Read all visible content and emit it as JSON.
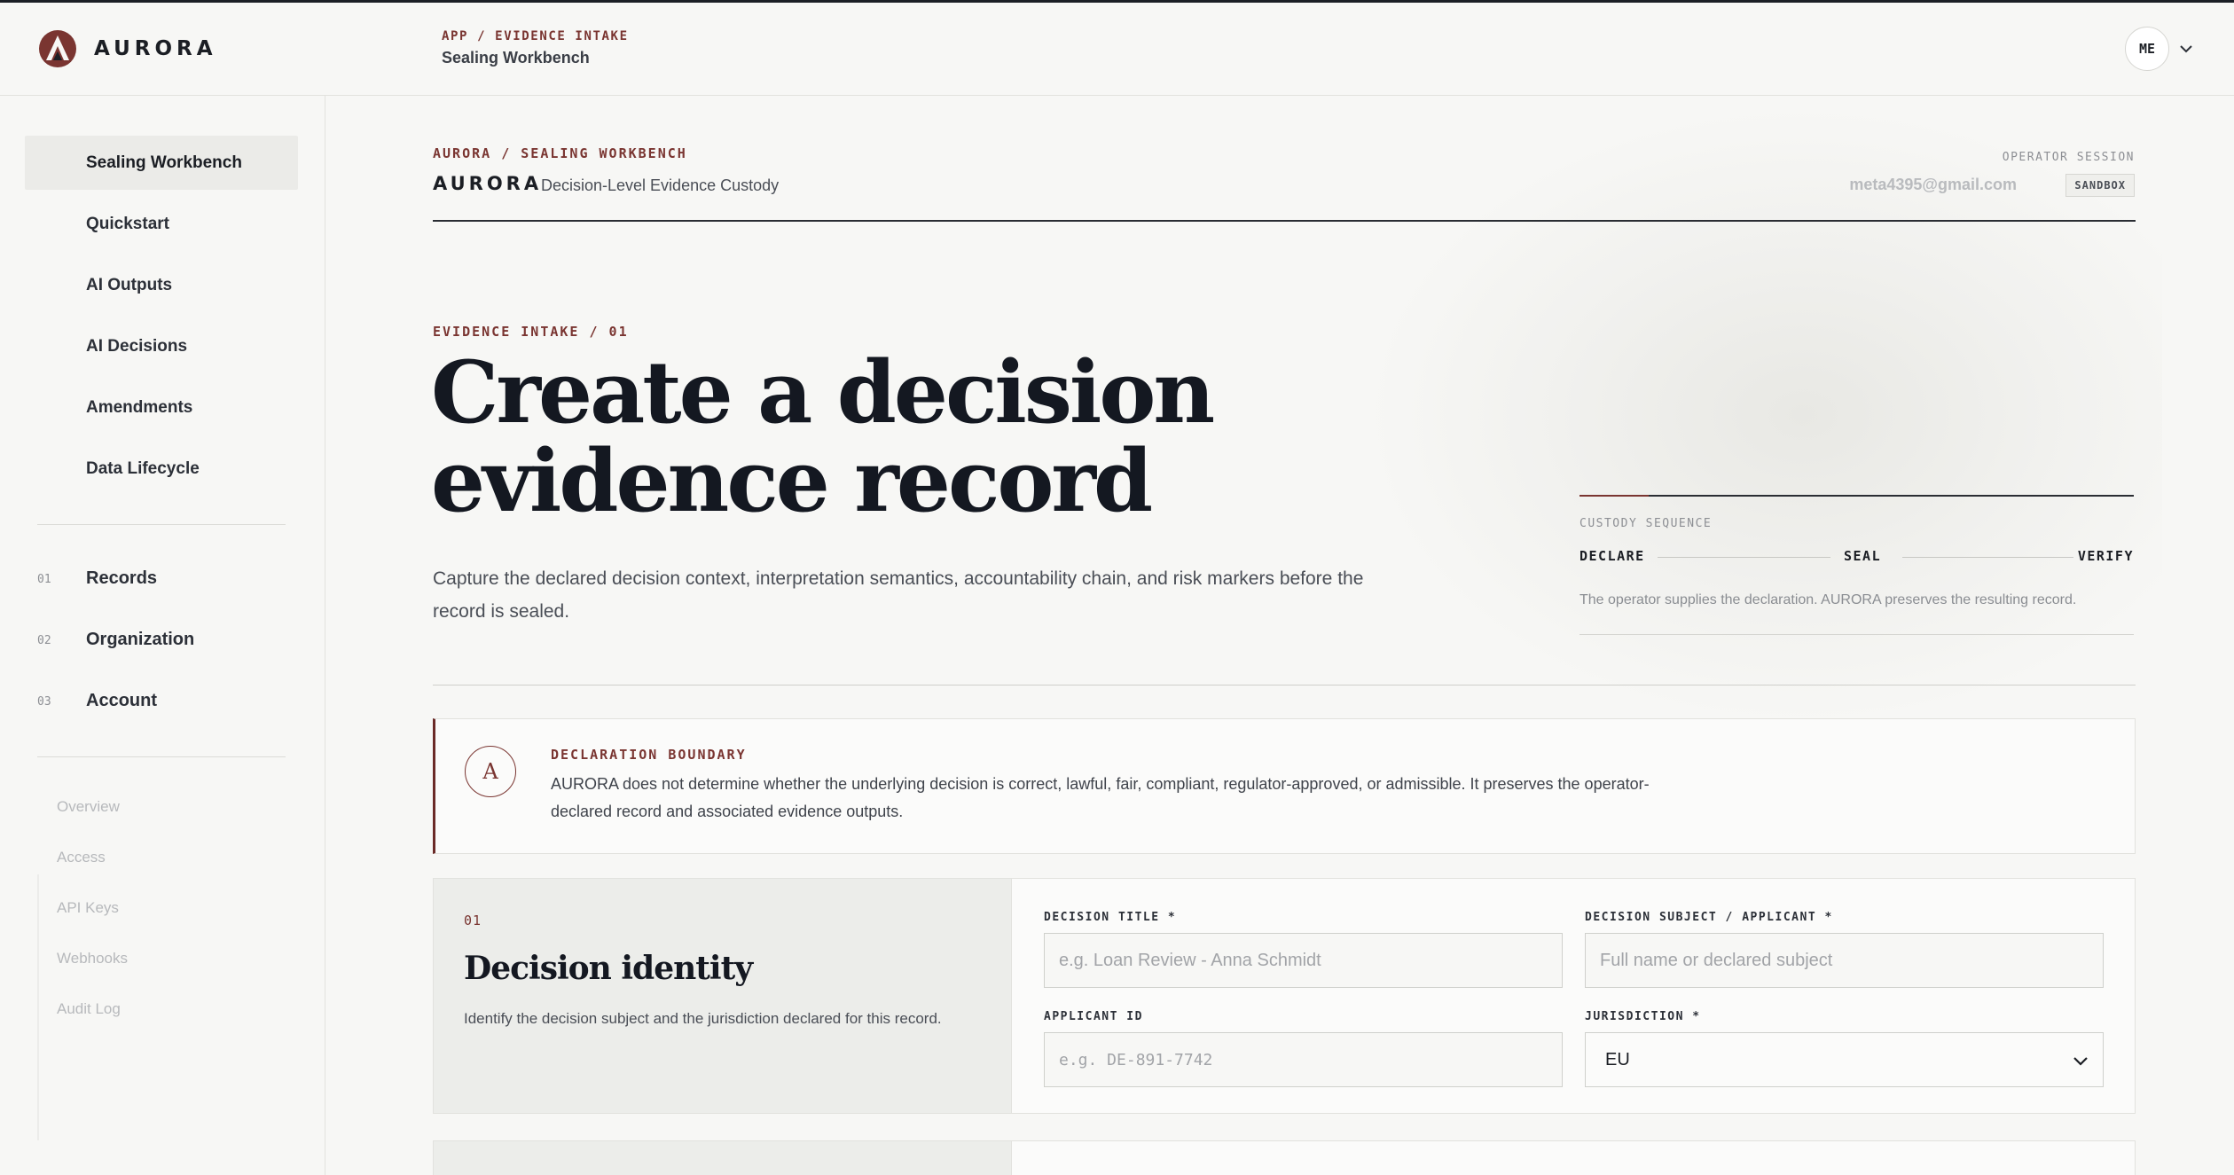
{
  "topbar": {
    "brand": "AURORA",
    "breadcrumb_path": "APP / EVIDENCE INTAKE",
    "breadcrumb_title": "Sealing Workbench",
    "user_initials": "ME"
  },
  "sidebar": {
    "primary": [
      {
        "label": "Sealing Workbench",
        "active": true
      },
      {
        "label": "Quickstart"
      },
      {
        "label": "AI Outputs"
      },
      {
        "label": "AI Decisions"
      },
      {
        "label": "Amendments"
      },
      {
        "label": "Data Lifecycle"
      }
    ],
    "numbered": [
      {
        "num": "01",
        "label": "Records"
      },
      {
        "num": "02",
        "label": "Organization"
      },
      {
        "num": "03",
        "label": "Account"
      }
    ],
    "secondary": [
      "Overview",
      "Access",
      "API Keys",
      "Webhooks",
      "Audit Log"
    ]
  },
  "header": {
    "crumb": "AURORA / SEALING WORKBENCH",
    "brand": "AURORA",
    "subtitle": "Decision-Level Evidence Custody",
    "operator_label": "OPERATOR SESSION",
    "operator_email": "meta4395@gmail.com",
    "env_badge": "SANDBOX"
  },
  "hero": {
    "label": "EVIDENCE INTAKE / 01",
    "title": "Create a decision evidence record",
    "description": "Capture the declared decision context, interpretation semantics, accountability chain, and risk markers before the record is sealed."
  },
  "custody": {
    "label": "CUSTODY SEQUENCE",
    "steps": [
      "DECLARE",
      "SEAL",
      "VERIFY"
    ],
    "note": "The operator supplies the declaration. AURORA preserves the resulting record."
  },
  "boundary": {
    "badge": "A",
    "title": "DECLARATION BOUNDARY",
    "text": "AURORA does not determine whether the underlying decision is correct, lawful, fair, compliant, regulator-approved, or admissible. It preserves the operator-declared record and associated evidence outputs."
  },
  "section1": {
    "num": "01",
    "title": "Decision identity",
    "description": "Identify the decision subject and the jurisdiction declared for this record.",
    "fields": {
      "decision_title_label": "DECISION TITLE *",
      "decision_title_placeholder": "e.g. Loan Review - Anna Schmidt",
      "subject_label": "DECISION SUBJECT / APPLICANT *",
      "subject_placeholder": "Full name or declared subject",
      "applicant_id_label": "APPLICANT ID",
      "applicant_id_placeholder": "e.g. DE-891-7742",
      "jurisdiction_label": "JURISDICTION *",
      "jurisdiction_value": "EU"
    }
  },
  "colors": {
    "accent": "#7a3531",
    "ink": "#141821",
    "background": "#f7f7f5",
    "panel": "#ecedea"
  },
  "icons": {
    "brand": "aurora-logo-icon",
    "user_menu": "chevron-down-icon",
    "select": "chevron-down-icon"
  }
}
